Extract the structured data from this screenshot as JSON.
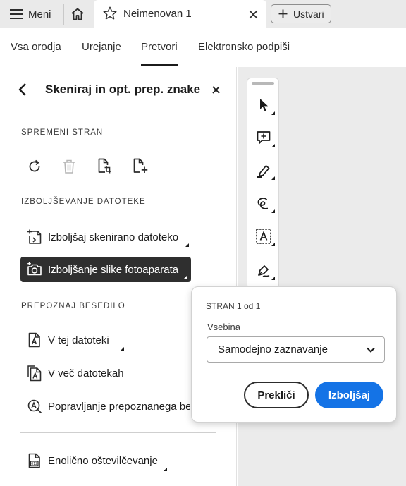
{
  "titlebar": {
    "menu_label": "Meni",
    "tab_title": "Neimenovan 1",
    "new_label": "Ustvari"
  },
  "tabs": [
    {
      "label": "Vsa orodja"
    },
    {
      "label": "Urejanje"
    },
    {
      "label": "Pretvori",
      "active": true
    },
    {
      "label": "Elektronsko podpiši"
    }
  ],
  "panel": {
    "title": "Skeniraj in opt. prep. znake",
    "section_page": "SPREMENI STRAN",
    "page_tools": [
      "rotate-icon",
      "delete-icon",
      "crop-page-icon",
      "insert-page-icon"
    ],
    "section_enhance": "IZBOLJŠEVANJE DATOTEKE",
    "enhance_items": [
      {
        "label": "Izboljšaj skenirano datoteko",
        "icon": "enhance-scan-icon",
        "has_submenu": true
      },
      {
        "label": "Izboljšanje slike fotoaparata",
        "icon": "camera-enhance-icon",
        "has_submenu": true,
        "selected": true
      }
    ],
    "section_recognize": "PREPOZNAJ BESEDILO",
    "recognize_items": [
      {
        "label": "V tej datoteki",
        "icon": "ocr-file-icon",
        "has_submenu": true
      },
      {
        "label": "V več datotekah",
        "icon": "ocr-multiple-files-icon"
      },
      {
        "label": "Popravljanje prepoznanega be",
        "icon": "correct-text-icon"
      }
    ],
    "bates_item": {
      "label": "Enolično oštevilčevanje",
      "icon": "bates-numbering-icon",
      "has_submenu": true
    }
  },
  "toolbar": [
    "select-arrow-icon",
    "add-comment-icon",
    "highlight-pen-icon",
    "draw-freehand-icon",
    "text-box-icon",
    "sign-icon"
  ],
  "popover": {
    "page_text": "STRAN 1 od 1",
    "content_label": "Vsebina",
    "content_value": "Samodejno zaznavanje",
    "cancel_label": "Prekliči",
    "apply_label": "Izboljšaj"
  },
  "colors": {
    "accent": "#1473e6",
    "selected_row": "#2f2f2f",
    "titlebar_bg": "#eaeaea",
    "canvas_bg": "#ebebeb"
  }
}
